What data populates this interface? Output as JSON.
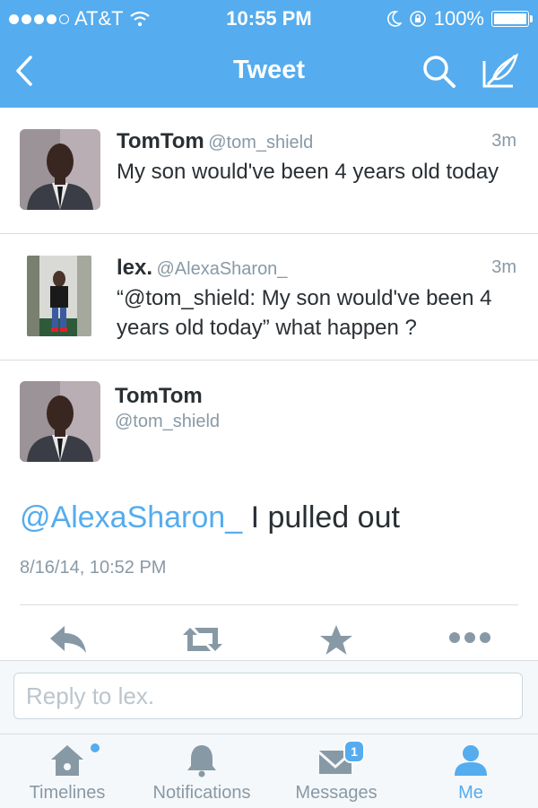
{
  "status_bar": {
    "carrier": "AT&T",
    "time": "10:55 PM",
    "battery": "100%"
  },
  "nav": {
    "title": "Tweet",
    "back_icon": "chevron-left-icon",
    "search_icon": "search-icon",
    "compose_icon": "compose-icon"
  },
  "tweets": [
    {
      "name": "TomTom",
      "handle": "@tom_shield",
      "time": "3m",
      "text": "My son would've been 4 years old today"
    },
    {
      "name": "lex.",
      "handle": "@AlexaSharon_",
      "time": "3m",
      "text": "“@tom_shield: My son would've been 4 years old today” what happen ?"
    }
  ],
  "detail": {
    "name": "TomTom",
    "handle": "@tom_shield",
    "mention": "@AlexaSharon_",
    "text": " I pulled out",
    "date": "8/16/14, 10:52 PM",
    "actions": [
      "reply-icon",
      "retweet-icon",
      "favorite-icon",
      "more-icon"
    ]
  },
  "reply": {
    "placeholder": "Reply to lex."
  },
  "tabs": [
    {
      "label": "Timelines",
      "icon": "home-icon",
      "active": false,
      "dot": true
    },
    {
      "label": "Notifications",
      "icon": "bell-icon",
      "active": false
    },
    {
      "label": "Messages",
      "icon": "envelope-icon",
      "active": false,
      "badge": "1"
    },
    {
      "label": "Me",
      "icon": "person-icon",
      "active": true
    }
  ],
  "colors": {
    "brand": "#55acee",
    "text": "#292f33",
    "muted": "#8899a6"
  }
}
